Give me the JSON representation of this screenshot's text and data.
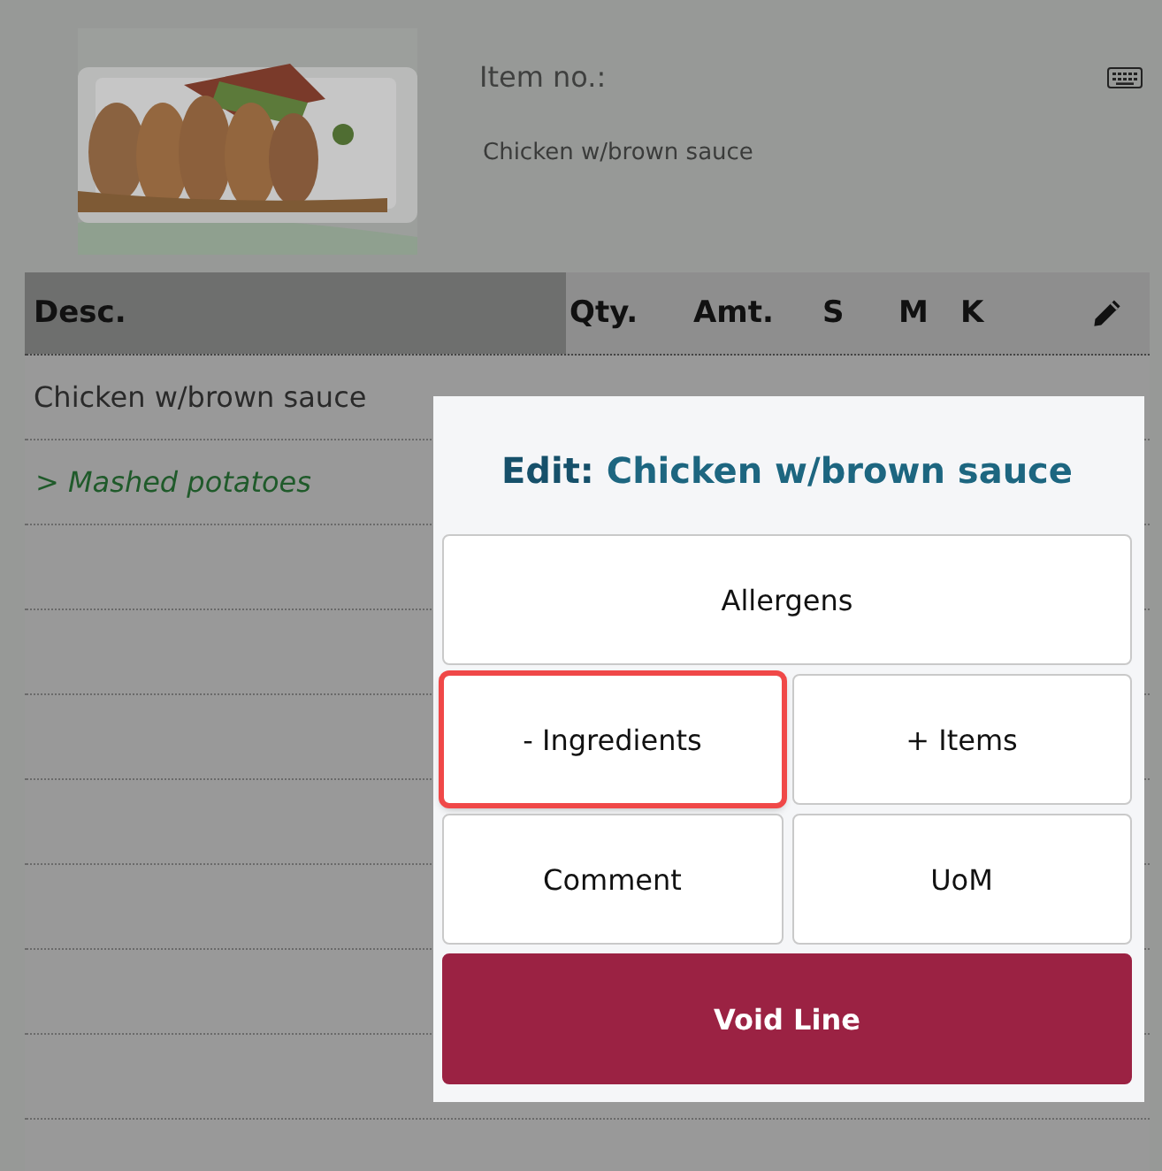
{
  "item": {
    "item_no_label": "Item no.:",
    "name": "Chicken w/brown sauce"
  },
  "table": {
    "columns": [
      {
        "label": "Desc.",
        "selected": true
      },
      {
        "label": "Qty.",
        "selected": false
      },
      {
        "label": "Amt.",
        "selected": false
      },
      {
        "label": "S",
        "selected": false
      },
      {
        "label": "M",
        "selected": false
      },
      {
        "label": "K",
        "selected": false
      }
    ],
    "rows": [
      {
        "kind": "item",
        "desc": "Chicken w/brown sauce"
      },
      {
        "kind": "modifier",
        "desc": "> Mashed potatoes"
      }
    ]
  },
  "dialog": {
    "title_prefix": "Edit:",
    "title": "Chicken w/brown sauce",
    "buttons": [
      {
        "kind": "wide",
        "label": "Allergens",
        "highlighted": false
      },
      {
        "kind": "half",
        "label": "- Ingredients",
        "highlighted": true
      },
      {
        "kind": "half",
        "label": "+ Items",
        "highlighted": false
      },
      {
        "kind": "half",
        "label": "Comment",
        "highlighted": false
      },
      {
        "kind": "half",
        "label": "UoM",
        "highlighted": false
      },
      {
        "kind": "danger",
        "label": "Void Line",
        "highlighted": false
      }
    ]
  }
}
